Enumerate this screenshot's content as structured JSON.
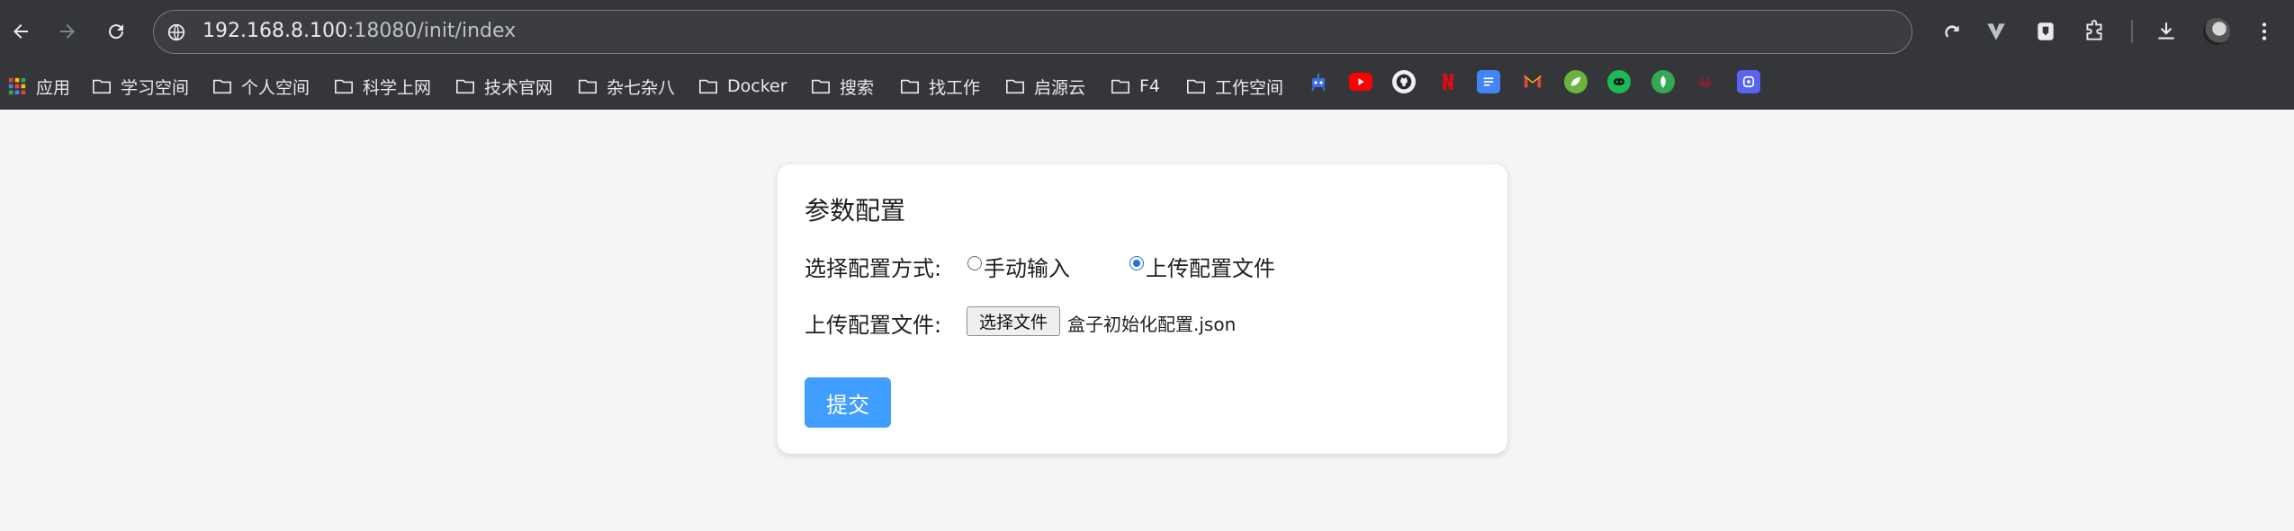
{
  "browser": {
    "url_host": "192.168.8.100",
    "url_rest": ":18080/init/index",
    "bookmarks": [
      {
        "label": "应用"
      },
      {
        "label": "学习空间"
      },
      {
        "label": "个人空间"
      },
      {
        "label": "科学上网"
      },
      {
        "label": "技术官网"
      },
      {
        "label": "杂七杂八"
      },
      {
        "label": "Docker"
      },
      {
        "label": "搜索"
      },
      {
        "label": "找工作"
      },
      {
        "label": "启源云"
      },
      {
        "label": "F4"
      },
      {
        "label": "工作空间"
      }
    ],
    "favicon_colors": [
      "#3b6ee8",
      "#ff0000",
      "#f0f0f0",
      "#e50914",
      "#4285f4",
      "#ea4335",
      "#6db33f",
      "#1db954",
      "#34a853",
      "#cf0a2c",
      "#5865f2"
    ]
  },
  "card": {
    "title": "参数配置",
    "mode_label": "选择配置方式:",
    "option_manual": "手动输入",
    "option_upload": "上传配置文件",
    "selected_option": "上传配置文件",
    "upload_label": "上传配置文件:",
    "choose_file_label": "选择文件",
    "file_name": "盒子初始化配置.json",
    "submit_label": "提交"
  },
  "colors": {
    "primary_button": "#409eff",
    "radio_checked": "#1a73e8",
    "chrome_bg": "#35363a"
  }
}
